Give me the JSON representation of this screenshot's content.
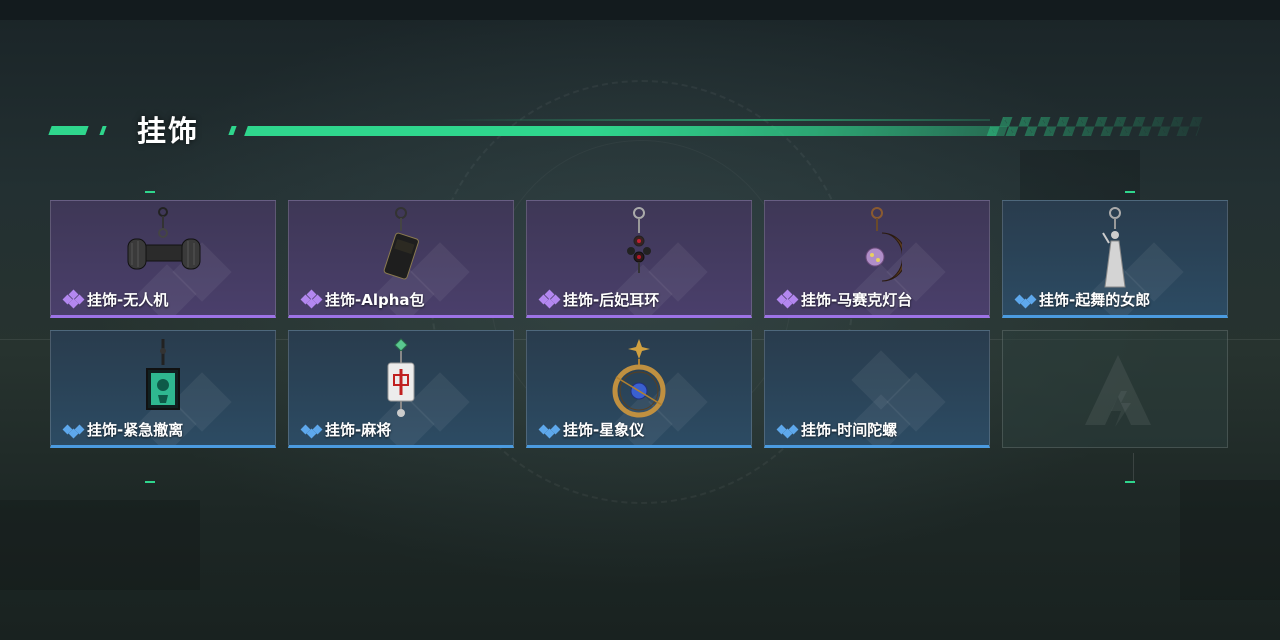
{
  "section": {
    "title": "挂饰",
    "accent_color": "#2fd68d"
  },
  "rarity_colors": {
    "epic": "#9d73e6",
    "rare": "#4b9be0"
  },
  "items": [
    {
      "label": "挂饰-无人机",
      "rarity": "epic",
      "icon": "drone-charm-icon"
    },
    {
      "label": "挂饰-Alpha包",
      "rarity": "epic",
      "icon": "alpha-bag-charm-icon"
    },
    {
      "label": "挂饰-后妃耳环",
      "rarity": "epic",
      "icon": "earring-charm-icon"
    },
    {
      "label": "挂饰-马赛克灯台",
      "rarity": "epic",
      "icon": "mosaic-lamp-charm-icon"
    },
    {
      "label": "挂饰-起舞的女郎",
      "rarity": "rare",
      "icon": "dancing-lady-charm-icon"
    },
    {
      "label": "挂饰-紧急撤离",
      "rarity": "rare",
      "icon": "emergency-exit-charm-icon"
    },
    {
      "label": "挂饰-麻将",
      "rarity": "rare",
      "icon": "mahjong-charm-icon"
    },
    {
      "label": "挂饰-星象仪",
      "rarity": "rare",
      "icon": "astrolabe-charm-icon"
    },
    {
      "label": "挂饰-时间陀螺",
      "rarity": "rare",
      "icon": "time-top-charm-icon"
    },
    {
      "label": "",
      "rarity": "empty",
      "icon": "empty-slot-logo-icon"
    }
  ]
}
